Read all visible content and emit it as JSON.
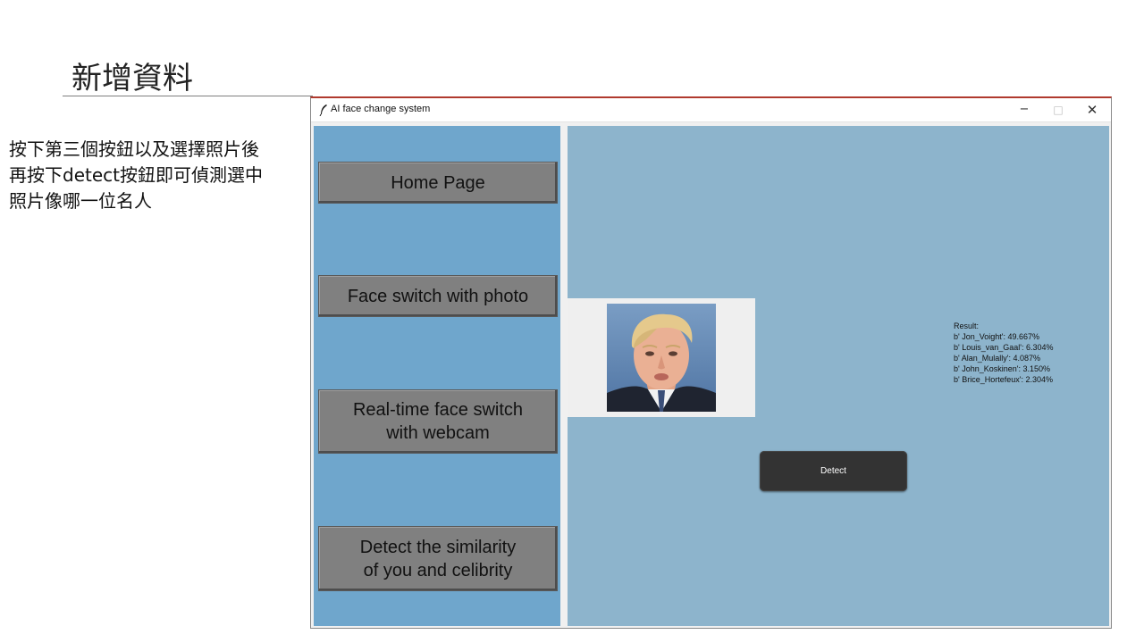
{
  "slide": {
    "title": "新增資料",
    "description": [
      "按下第三個按鈕以及選擇照片後",
      "再按下detect按鈕即可偵測選中",
      "照片像哪一位名人"
    ]
  },
  "window": {
    "title": "AI face change system",
    "controls": {
      "minimize": "−",
      "maximize": "□",
      "close": "✕"
    }
  },
  "sidebar": {
    "buttons": [
      {
        "label": "Home Page"
      },
      {
        "label": "Face switch with photo"
      },
      {
        "label": "Real-time face switch\nwith webcam"
      },
      {
        "label": "Detect the similarity\nof you and celibrity"
      }
    ]
  },
  "main": {
    "result_lines": [
      "Result:",
      "b' Jon_Voight': 49.667%",
      "b' Louis_van_Gaal': 6.304%",
      "b' Alan_Mulally': 4.087%",
      "b' John_Koskinen': 3.150%",
      "b' Brice_Hortefeux': 2.304%"
    ],
    "detect_label": "Detect",
    "photo_icon": "face-photo"
  },
  "colors": {
    "sidebar_bg": "#6fa6cc",
    "main_bg": "#8db4cc",
    "nav_button_bg": "#808080",
    "detect_button_bg": "#333333",
    "window_accent": "#b03a2e"
  }
}
